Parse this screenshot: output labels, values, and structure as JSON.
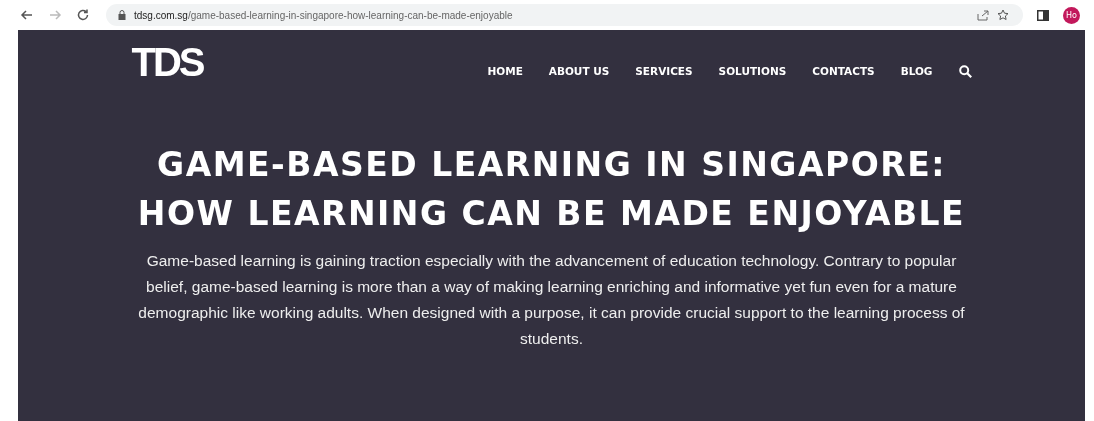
{
  "browser": {
    "url_domain": "tdsg.com.sg",
    "url_path": "/game-based-learning-in-singapore-how-learning-can-be-made-enjoyable",
    "profile": "Ho"
  },
  "header": {
    "logo": "TDS",
    "nav": [
      {
        "label": "HOME"
      },
      {
        "label": "ABOUT US"
      },
      {
        "label": "SERVICES"
      },
      {
        "label": "SOLUTIONS"
      },
      {
        "label": "CONTACTS"
      },
      {
        "label": "BLOG"
      }
    ]
  },
  "article": {
    "title": "GAME-BASED LEARNING IN SINGAPORE: HOW LEARNING CAN BE MADE ENJOYABLE",
    "intro": "Game-based learning is gaining traction especially with the advancement of education technology. Contrary to popular belief, game-based learning is more than a way of making learning enriching and informative yet fun even for a mature demographic like working adults. When designed with a purpose, it can provide crucial support to the learning process of students."
  }
}
